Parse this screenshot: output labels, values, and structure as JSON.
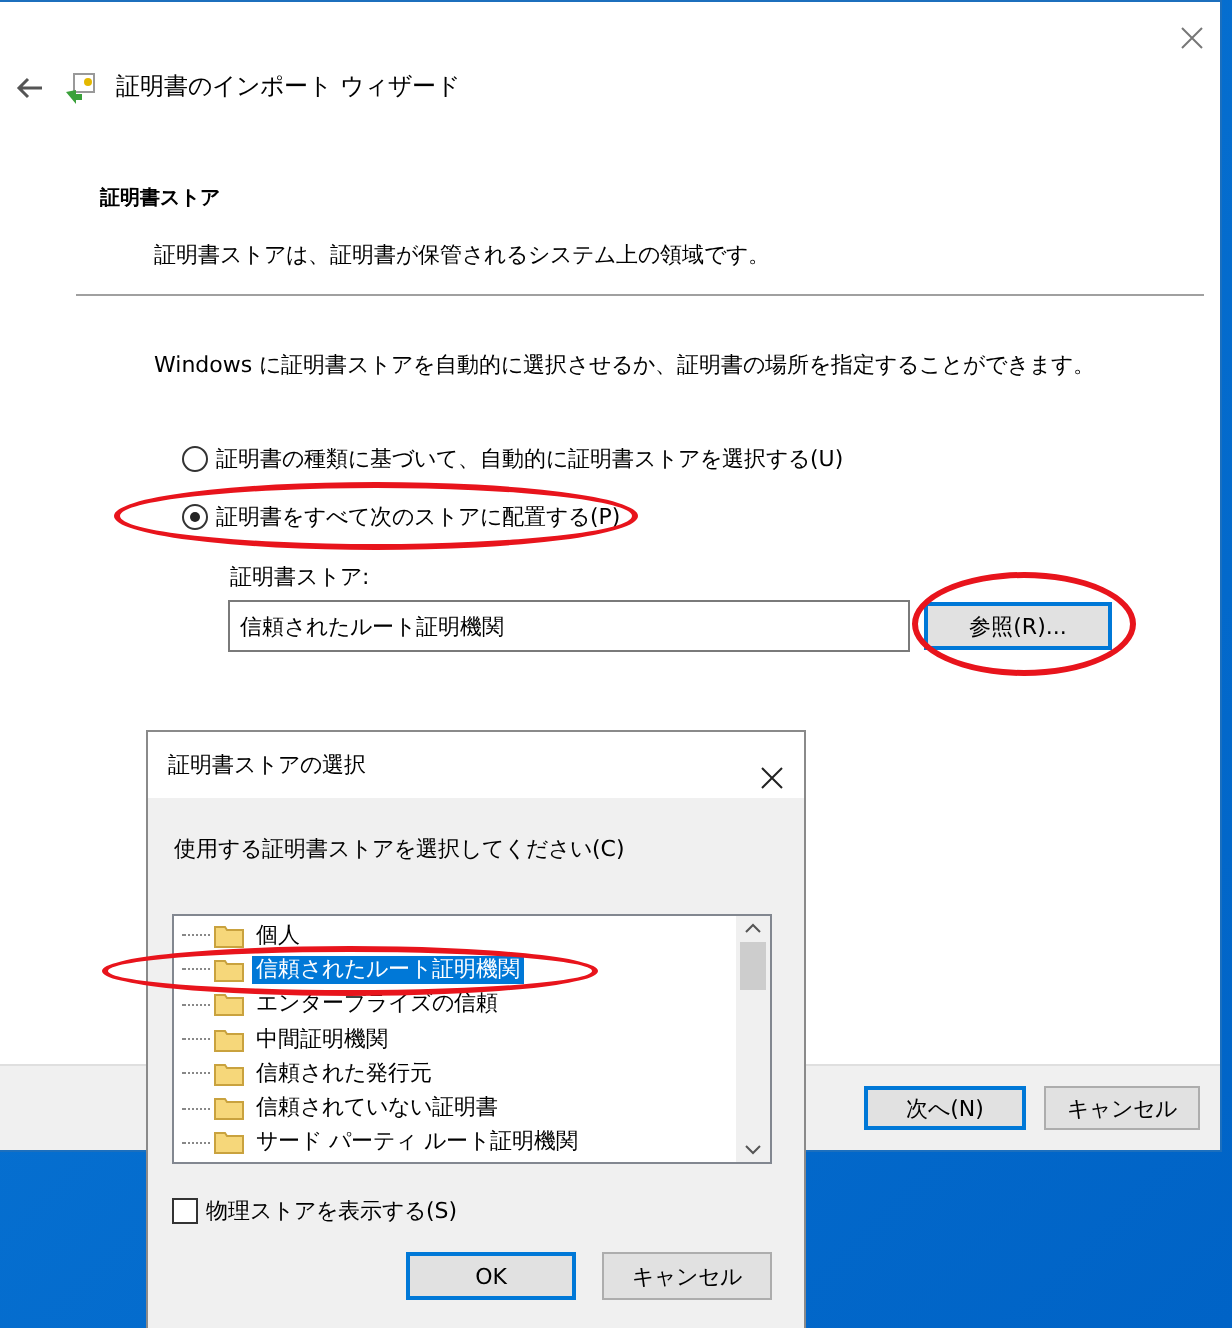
{
  "wizard": {
    "title": "証明書のインポート ウィザード",
    "section_title": "証明書ストア",
    "section_description": "証明書ストアは、証明書が保管されるシステム上の領域です。",
    "instruction": "Windows に証明書ストアを自動的に選択させるか、証明書の場所を指定することができます。",
    "options": [
      {
        "label": "証明書の種類に基づいて、自動的に証明書ストアを選択する(U)",
        "selected": false
      },
      {
        "label": "証明書をすべて次のストアに配置する(P)",
        "selected": true
      }
    ],
    "store_label": "証明書ストア:",
    "store_field": {
      "value": "信頼されたルート証明機関"
    },
    "browse_button": "参照(R)...",
    "buttons": [
      {
        "label": "次へ(N)",
        "default": true
      },
      {
        "label": "キャンセル",
        "default": false
      }
    ]
  },
  "dialog": {
    "title": "証明書ストアの選択",
    "prompt": "使用する証明書ストアを選択してください(C)",
    "stores": [
      {
        "label": "個人",
        "selected": false
      },
      {
        "label": "信頼されたルート証明機関",
        "selected": true
      },
      {
        "label": "エンタープライズの信頼",
        "selected": false
      },
      {
        "label": "中間証明機関",
        "selected": false
      },
      {
        "label": "信頼された発行元",
        "selected": false
      },
      {
        "label": "信頼されていない証明書",
        "selected": false
      },
      {
        "label": "サード パーティ ルート証明機関",
        "selected": false
      }
    ],
    "show_physical": {
      "label": "物理ストアを表示する(S)",
      "checked": false
    },
    "buttons": [
      {
        "label": "OK",
        "default": true
      },
      {
        "label": "キャンセル",
        "default": false
      }
    ]
  }
}
